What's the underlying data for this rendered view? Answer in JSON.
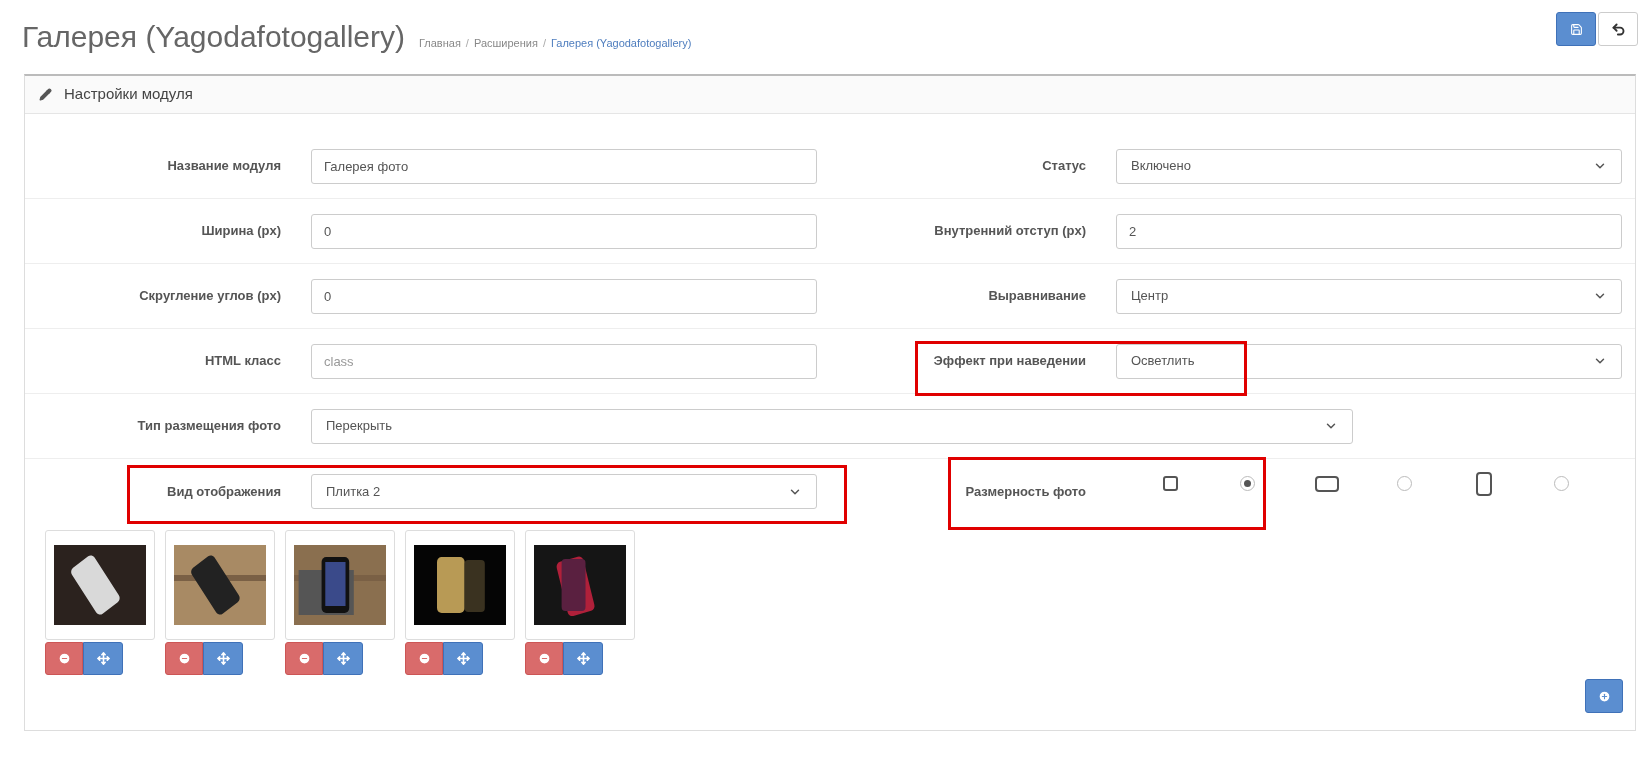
{
  "page": {
    "title": "Галерея (Yagodafotogallery)",
    "breadcrumbs": [
      {
        "label": "Главная",
        "current": false
      },
      {
        "separator": "/",
        "label": "Расширения",
        "current": false
      },
      {
        "separator": "/",
        "label": "Галерея (Yagodafotogallery)",
        "current": true
      }
    ]
  },
  "panel": {
    "title": "Настройки модуля"
  },
  "rows": [
    [
      {
        "label": "Название модуля",
        "kind": "input",
        "value": "Галерея фото"
      },
      {
        "label": "Статус",
        "kind": "select",
        "value": "Включено"
      }
    ],
    [
      {
        "label": "Ширина (px)",
        "kind": "input",
        "value": "0"
      },
      {
        "label": "Внутренний отступ (px)",
        "kind": "input",
        "value": "2"
      }
    ],
    [
      {
        "label": "Скругление углов (px)",
        "kind": "input",
        "value": "0"
      },
      {
        "label": "Выравнивание",
        "kind": "select",
        "value": "Центр"
      }
    ],
    [
      {
        "label": "HTML класс",
        "kind": "input",
        "placeholder": "class"
      },
      {
        "label": "Эффект при наведении",
        "kind": "select",
        "value": "Осветлить",
        "highlighted": true
      }
    ],
    [
      {
        "label": "Тип размещения фото",
        "kind": "wide-select",
        "value": "Перекрыть"
      }
    ],
    [
      {
        "label": "Вид отображения",
        "kind": "select",
        "value": "Плитка 2",
        "highlighted": true
      },
      {
        "label": "Размерность фото",
        "kind": "shape-radios",
        "highlighted": true
      }
    ]
  ],
  "size_options": [
    {
      "kind": "square",
      "selected": true
    },
    {
      "kind": "landscape",
      "selected": false
    },
    {
      "kind": "portrait",
      "selected": false
    }
  ],
  "photos": [
    {
      "kind": "picture"
    },
    {
      "kind": "picture"
    },
    {
      "kind": "picture"
    },
    {
      "kind": "picture"
    },
    {
      "kind": "picture"
    }
  ]
}
